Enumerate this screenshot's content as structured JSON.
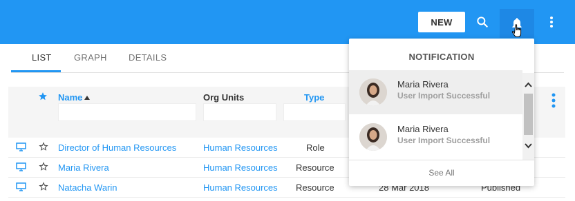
{
  "toolbar": {
    "new_label": "NEW",
    "search_icon": "search-icon",
    "bell_icon": "bell-icon",
    "more_icon": "more-vert-icon",
    "brand_color": "#2196f3"
  },
  "tabs": [
    {
      "label": "LIST",
      "active": true
    },
    {
      "label": "GRAPH",
      "active": false
    },
    {
      "label": "DETAILS",
      "active": false
    }
  ],
  "table": {
    "columns": {
      "name": "Name",
      "org_units": "Org Units",
      "type": "Type"
    },
    "rows": [
      {
        "name": "Director of Human Resources",
        "org_unit": "Human Resources",
        "type": "Role",
        "date": "",
        "status": ""
      },
      {
        "name": "Maria Rivera",
        "org_unit": "Human Resources",
        "type": "Resource",
        "date": "",
        "status": ""
      },
      {
        "name": "Natacha Warin",
        "org_unit": "Human Resources",
        "type": "Resource",
        "date": "28 Mar 2018",
        "status": "Published"
      }
    ]
  },
  "notifications": {
    "title": "NOTIFICATION",
    "items": [
      {
        "name": "Maria Rivera",
        "message": "User Import Successful"
      },
      {
        "name": "Maria Rivera",
        "message": "User Import Successful"
      }
    ],
    "see_all": "See All"
  }
}
